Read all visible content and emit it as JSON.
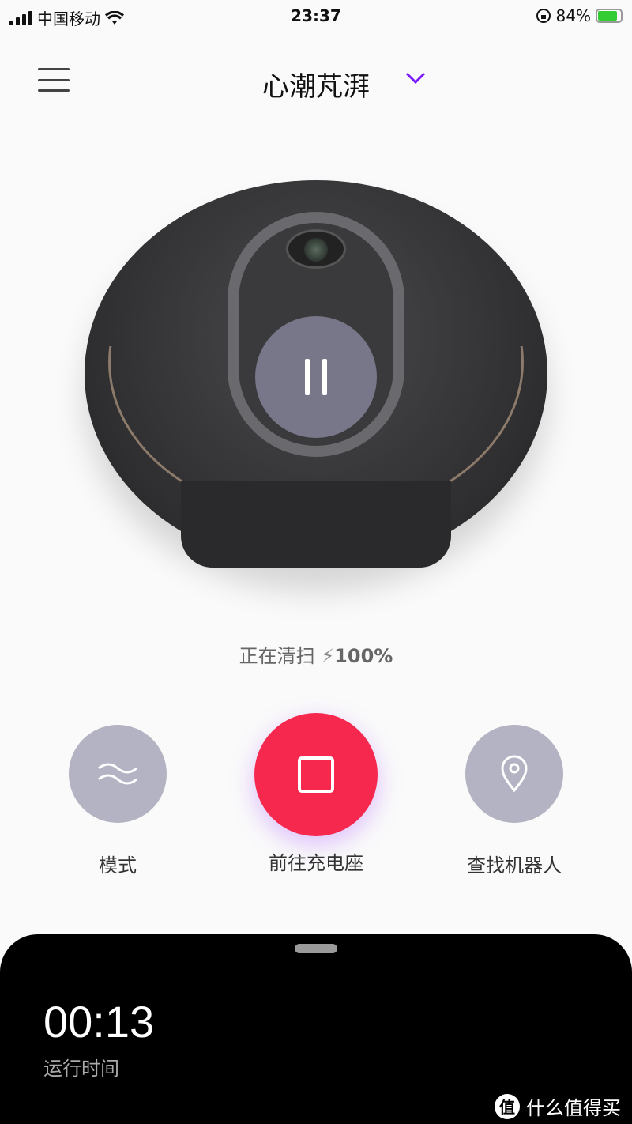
{
  "status_bar": {
    "carrier": "中国移动",
    "time": "23:37",
    "battery": "84%",
    "battery_level": 0.84,
    "battery_color": "#33cc33"
  },
  "header": {
    "title": "心潮芃湃",
    "menu_icon": "hamburger-icon",
    "dropdown_icon": "chevron-down-icon",
    "accent": "#7a1cff"
  },
  "robot": {
    "control_icon": "pause-icon"
  },
  "status": {
    "text": "正在清扫",
    "charge_icon": "lightning-icon",
    "battery": "100%"
  },
  "actions": [
    {
      "label": "模式",
      "icon": "waves-icon",
      "color": "#b3b3c3"
    },
    {
      "label": "前往充电座",
      "icon": "stop-icon",
      "color": "#f6284e"
    },
    {
      "label": "查找机器人",
      "icon": "location-pin-icon",
      "color": "#b3b3c3"
    }
  ],
  "sheet": {
    "runtime": "00:13",
    "runtime_label": "运行时间"
  },
  "watermark": {
    "logo_char": "值",
    "text": "什么值得买"
  }
}
